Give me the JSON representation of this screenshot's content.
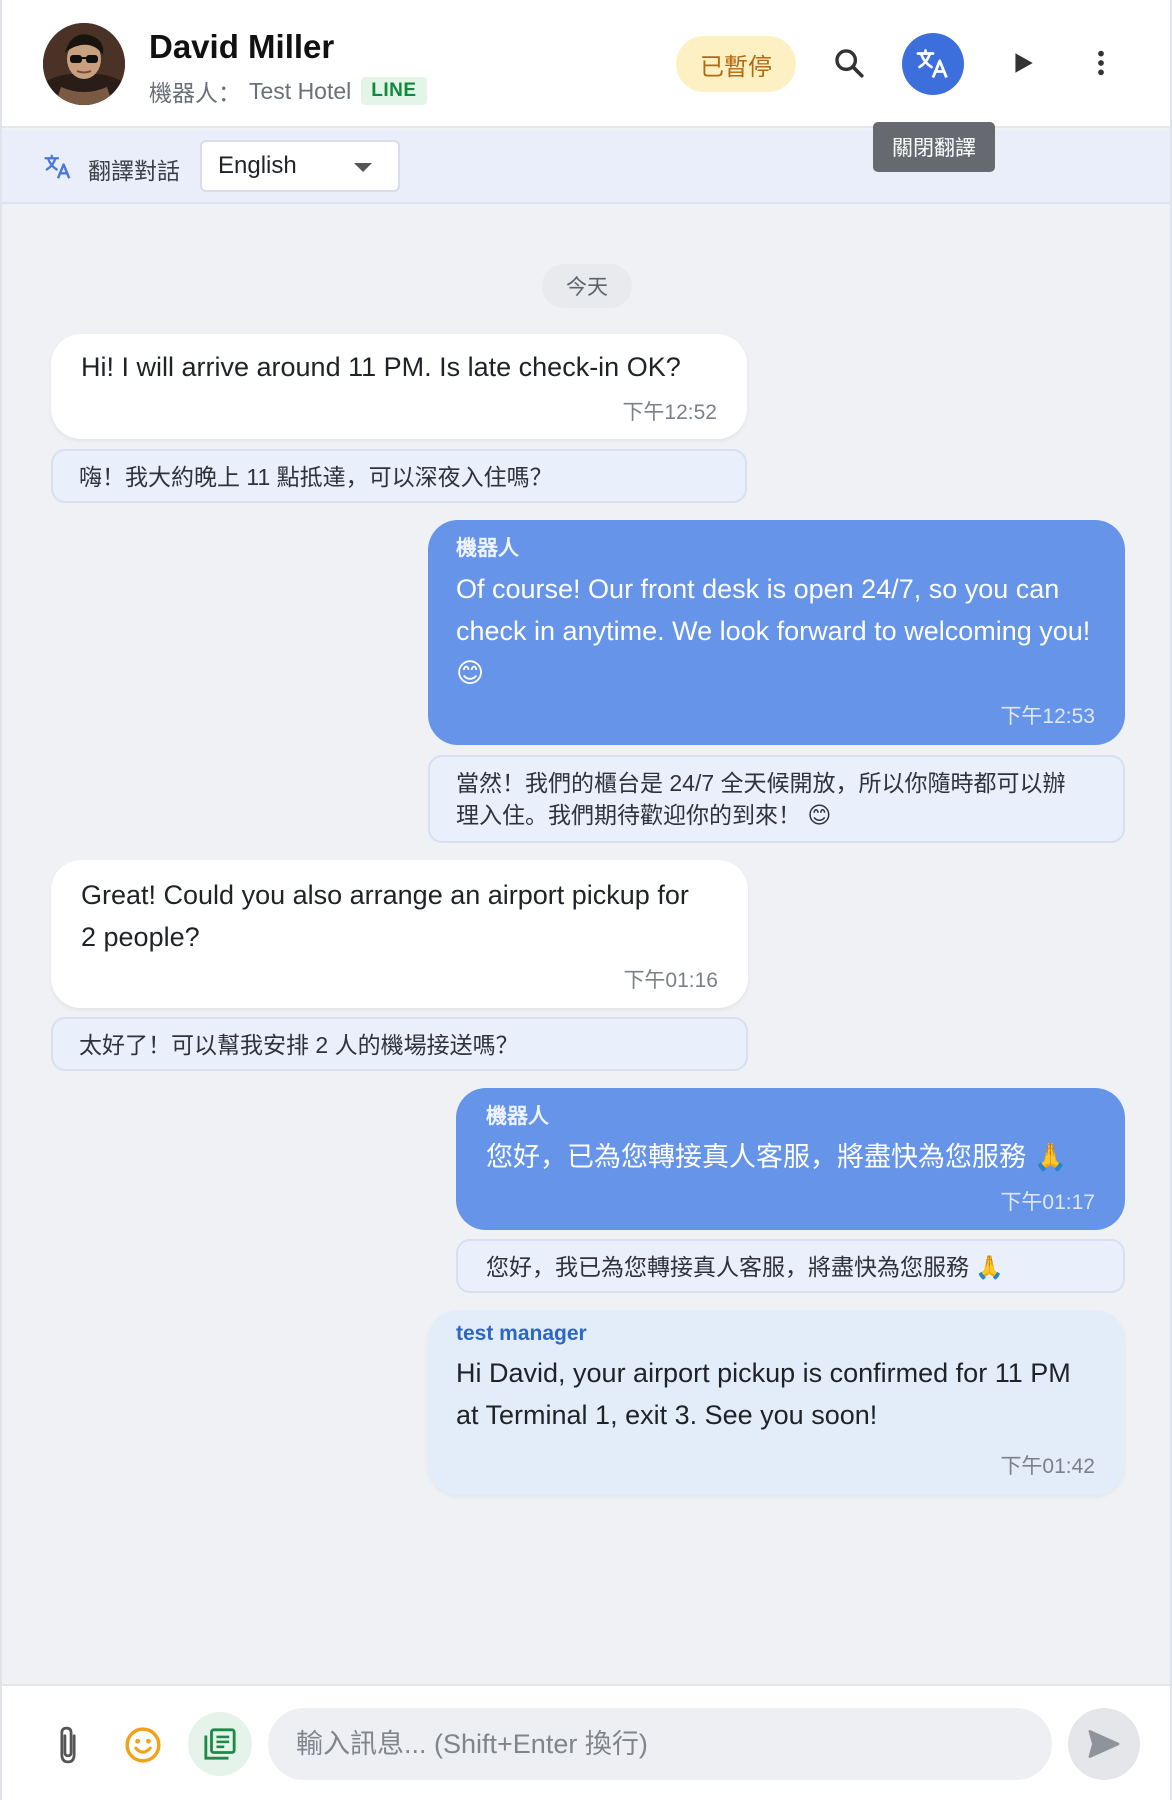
{
  "header": {
    "contact_name": "David Miller",
    "handler_label": "機器人：",
    "hotel_name": "Test Hotel",
    "channel_badge": "LINE",
    "status_badge": "已暫停",
    "translate_tooltip": "關閉翻譯"
  },
  "translate_bar": {
    "label": "翻譯對話",
    "selected_language": "English"
  },
  "date_divider": "今天",
  "messages": [
    {
      "direction": "incoming",
      "text": "Hi! I will arrive around 11 PM. Is late check-in OK?",
      "time": "下午12:52",
      "translation": "嗨！我大約晚上 11 點抵達，可以深夜入住嗎？"
    },
    {
      "direction": "outgoing",
      "sender": "機器人",
      "text": "Of course! Our front desk is open 24/7, so you can check in anytime. We look forward to welcoming you!",
      "emoji": "😊",
      "time": "下午12:53",
      "translation_line1": "當然！我們的櫃台是 24/7 全天候開放，所以你隨時都可以辦",
      "translation_line2": "理入住。我們期待歡迎你的到來！",
      "translation_emoji": "😊"
    },
    {
      "direction": "incoming",
      "text": "Great! Could you also arrange an airport pickup for 2 people?",
      "time": "下午01:16",
      "translation": "太好了！可以幫我安排 2 人的機場接送嗎？"
    },
    {
      "direction": "outgoing",
      "sender": "機器人",
      "text": "您好，已為您轉接真人客服，將盡快為您服務",
      "emoji": "🙏",
      "time": "下午01:17",
      "translation": "您好，我已為您轉接真人客服，將盡快為您服務",
      "translation_emoji": "🙏"
    },
    {
      "direction": "staff",
      "sender": "test manager",
      "text": "Hi David, your airport pickup is confirmed for 11 PM at Terminal 1, exit 3. See you soon!",
      "time": "下午01:42"
    }
  ],
  "composer": {
    "placeholder": "輸入訊息... (Shift+Enter 換行)"
  },
  "colors": {
    "accent": "#3c6fdc",
    "outgoing_bubble": "#6594e9",
    "staff_bubble": "#e3edfa",
    "paused_badge_bg": "#fdf1c4",
    "line_green": "#0f8a3c"
  },
  "icons": [
    "avatar",
    "search-icon",
    "translate-icon",
    "play-icon",
    "more-vert-icon",
    "attach-icon",
    "emoji-icon",
    "template-icon",
    "send-icon"
  ]
}
